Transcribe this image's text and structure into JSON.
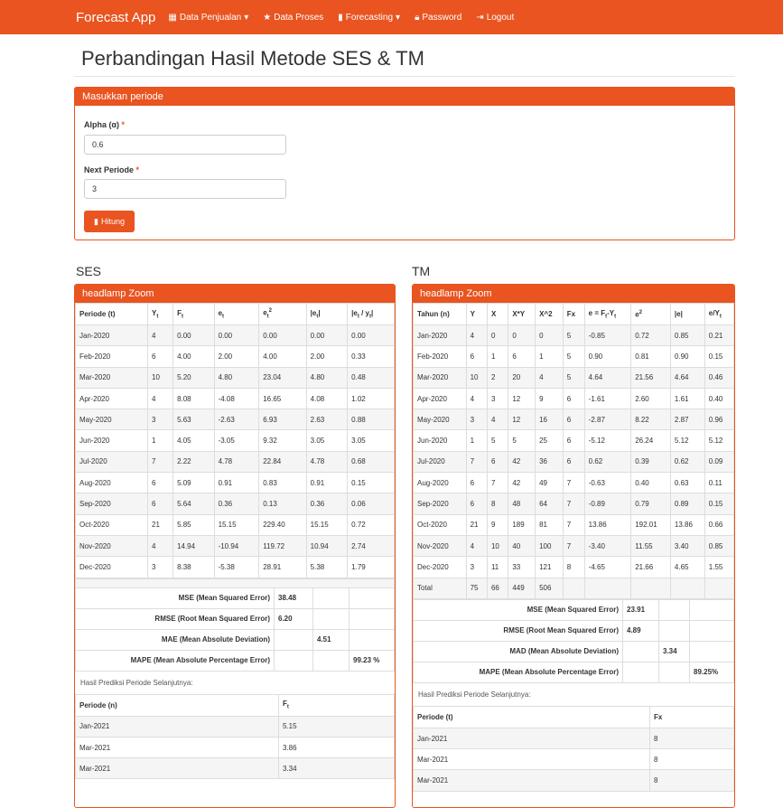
{
  "nav": {
    "brand": "Forecast App",
    "items": [
      {
        "icon": "grid-icon",
        "label": "Data Penjualan",
        "caret": true
      },
      {
        "icon": "star-icon",
        "label": "Data Proses",
        "caret": false
      },
      {
        "icon": "bar-chart-icon",
        "label": "Forecasting",
        "caret": true
      },
      {
        "icon": "lock-icon",
        "label": "Password",
        "caret": false
      },
      {
        "icon": "logout-icon",
        "label": "Logout",
        "caret": false
      }
    ]
  },
  "page_title": "Perbandingan Hasil Metode SES & TM",
  "form": {
    "heading": "Masukkan periode",
    "alpha_label": "Alpha (α)",
    "alpha_value": "0.6",
    "next_label": "Next Periode",
    "next_value": "3",
    "required_mark": "*",
    "button_label": "Hitung"
  },
  "ses": {
    "title": "SES",
    "heading": "headlamp Zoom",
    "rows": [
      [
        "Jan-2020",
        "4",
        "0.00",
        "0.00",
        "0.00",
        "0.00",
        "0.00"
      ],
      [
        "Feb-2020",
        "6",
        "4.00",
        "2.00",
        "4.00",
        "2.00",
        "0.33"
      ],
      [
        "Mar-2020",
        "10",
        "5.20",
        "4.80",
        "23.04",
        "4.80",
        "0.48"
      ],
      [
        "Apr-2020",
        "4",
        "8.08",
        "-4.08",
        "16.65",
        "4.08",
        "1.02"
      ],
      [
        "May-2020",
        "3",
        "5.63",
        "-2.63",
        "6.93",
        "2.63",
        "0.88"
      ],
      [
        "Jun-2020",
        "1",
        "4.05",
        "-3.05",
        "9.32",
        "3.05",
        "3.05"
      ],
      [
        "Jul-2020",
        "7",
        "2.22",
        "4.78",
        "22.84",
        "4.78",
        "0.68"
      ],
      [
        "Aug-2020",
        "6",
        "5.09",
        "0.91",
        "0.83",
        "0.91",
        "0.15"
      ],
      [
        "Sep-2020",
        "6",
        "5.64",
        "0.36",
        "0.13",
        "0.36",
        "0.06"
      ],
      [
        "Oct-2020",
        "21",
        "5.85",
        "15.15",
        "229.40",
        "15.15",
        "0.72"
      ],
      [
        "Nov-2020",
        "4",
        "14.94",
        "-10.94",
        "119.72",
        "10.94",
        "2.74"
      ],
      [
        "Dec-2020",
        "3",
        "8.38",
        "-5.38",
        "28.91",
        "5.38",
        "1.79"
      ]
    ],
    "metrics": {
      "mse_label": "MSE (Mean Squared Error)",
      "mse": "38.48",
      "rmse_label": "RMSE (Root Mean Squared Error)",
      "rmse": "6.20",
      "mae_label": "MAE (Mean Absolute Deviation)",
      "mae": "4.51",
      "mape_label": "MAPE (Mean Absolute Percentage Error)",
      "mape": "99.23 %"
    },
    "pred_title": "Hasil Prediksi Periode Selanjutnya:",
    "pred_col1": "Periode (n)",
    "pred_rows": [
      [
        "Jan-2021",
        "5.15"
      ],
      [
        "Mar-2021",
        "3.86"
      ],
      [
        "Mar-2021",
        "3.34"
      ]
    ]
  },
  "tm": {
    "title": "TM",
    "heading": "headlamp Zoom",
    "headers": [
      "Tahun (n)",
      "Y",
      "X",
      "X*Y",
      "X^2",
      "Fx"
    ],
    "rows": [
      [
        "Jan-2020",
        "4",
        "0",
        "0",
        "0",
        "5",
        "-0.85",
        "0.72",
        "0.85",
        "0.21"
      ],
      [
        "Feb-2020",
        "6",
        "1",
        "6",
        "1",
        "5",
        "0.90",
        "0.81",
        "0.90",
        "0.15"
      ],
      [
        "Mar-2020",
        "10",
        "2",
        "20",
        "4",
        "5",
        "4.64",
        "21.56",
        "4.64",
        "0.46"
      ],
      [
        "Apr-2020",
        "4",
        "3",
        "12",
        "9",
        "6",
        "-1.61",
        "2.60",
        "1.61",
        "0.40"
      ],
      [
        "May-2020",
        "3",
        "4",
        "12",
        "16",
        "6",
        "-2.87",
        "8.22",
        "2.87",
        "0.96"
      ],
      [
        "Jun-2020",
        "1",
        "5",
        "5",
        "25",
        "6",
        "-5.12",
        "26.24",
        "5.12",
        "5.12"
      ],
      [
        "Jul-2020",
        "7",
        "6",
        "42",
        "36",
        "6",
        "0.62",
        "0.39",
        "0.62",
        "0.09"
      ],
      [
        "Aug-2020",
        "6",
        "7",
        "42",
        "49",
        "7",
        "-0.63",
        "0.40",
        "0.63",
        "0.11"
      ],
      [
        "Sep-2020",
        "6",
        "8",
        "48",
        "64",
        "7",
        "-0.89",
        "0.79",
        "0.89",
        "0.15"
      ],
      [
        "Oct-2020",
        "21",
        "9",
        "189",
        "81",
        "7",
        "13.86",
        "192.01",
        "13.86",
        "0.66"
      ],
      [
        "Nov-2020",
        "4",
        "10",
        "40",
        "100",
        "7",
        "-3.40",
        "11.55",
        "3.40",
        "0.85"
      ],
      [
        "Dec-2020",
        "3",
        "11",
        "33",
        "121",
        "8",
        "-4.65",
        "21.66",
        "4.65",
        "1.55"
      ]
    ],
    "total": [
      "Total",
      "75",
      "66",
      "449",
      "506"
    ],
    "metrics": {
      "mse_label": "MSE (Mean Squared Error)",
      "mse": "23.91",
      "rmse_label": "RMSE (Root Mean Squared Error)",
      "rmse": "4.89",
      "mad_label": "MAD (Mean Absolute Deviation)",
      "mad": "3.34",
      "mape_label": "MAPE (Mean Absolute Percentage Error)",
      "mape": "89.25%"
    },
    "pred_title": "Hasil Prediksi Periode Selanjutnya:",
    "pred_col1": "Periode (t)",
    "pred_col2": "Fx",
    "pred_rows": [
      [
        "Jan-2021",
        "8"
      ],
      [
        "Mar-2021",
        "8"
      ],
      [
        "Mar-2021",
        "8"
      ]
    ]
  },
  "colors": {
    "accent": "#e95420"
  }
}
